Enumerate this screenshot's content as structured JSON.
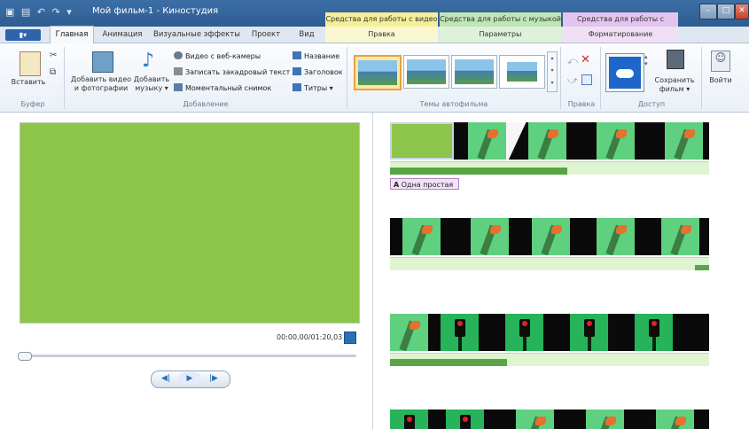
{
  "titlebar": {
    "window_title": "Мой фильм-1 - Киностудия",
    "context_tabs": [
      "Средства для работы с видео",
      "Средства для работы с музыкой",
      "Средства для работы с текстом"
    ]
  },
  "tabs": {
    "file": "▮▾",
    "main": [
      "Главная",
      "Анимация",
      "Визуальные эффекты",
      "Проект",
      "Вид"
    ],
    "context": [
      "Правка",
      "Параметры",
      "Форматирование"
    ]
  },
  "ribbon": {
    "paste": "Вставить",
    "add_video_photos": [
      "Добавить видео",
      "и фотографии"
    ],
    "add_music": [
      "Добавить",
      "музыку ▾"
    ],
    "webcam": "Видео с веб-камеры",
    "voiceover": "Записать закадровый текст ▾",
    "snapshot": "Моментальный снимок",
    "name": "Название",
    "heading": "Заголовок",
    "credits": "Титры ▾",
    "save_movie": [
      "Сохранить",
      "фильм ▾"
    ],
    "sign_in": "Войти",
    "groups": {
      "clipboard": "Буфер",
      "add": "Добавление",
      "themes": "Темы автофильма",
      "edit": "Правка",
      "share": "Доступ"
    }
  },
  "preview": {
    "timecode": "00:00,00/01:20,03",
    "player_buttons": [
      "◀|",
      "▶",
      "|▶"
    ]
  },
  "storyboard": {
    "caption": "Одна простая",
    "caption_icon": "A"
  }
}
